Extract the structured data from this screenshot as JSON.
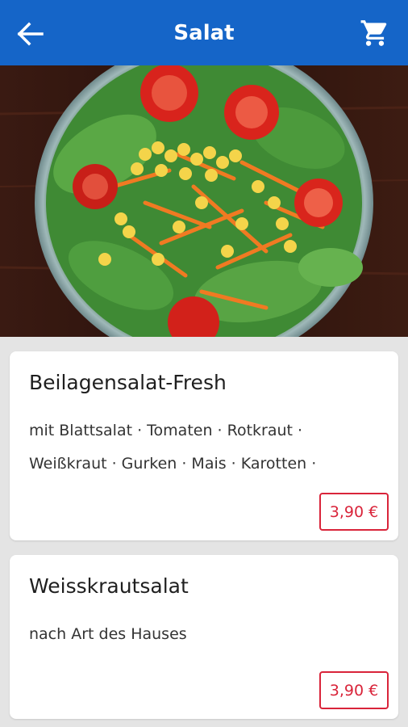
{
  "header": {
    "title": "Salat",
    "back_icon": "arrow-back-icon",
    "cart_icon": "shopping-cart-icon",
    "background": "#1565c8"
  },
  "hero": {
    "image": "salad-bowl-photo"
  },
  "items": [
    {
      "name": "Beilagensalat-Fresh",
      "description": "mit Blattsalat · Tomaten · Rotkraut · Weißkraut · Gurken · Mais · Karotten ·",
      "price": "3,90 €"
    },
    {
      "name": "Weisskrautsalat",
      "description": "nach Art des Hauses",
      "price": "3,90 €"
    }
  ],
  "colors": {
    "accent": "#1565c8",
    "price": "#d9243a",
    "background": "#e4e4e4"
  }
}
